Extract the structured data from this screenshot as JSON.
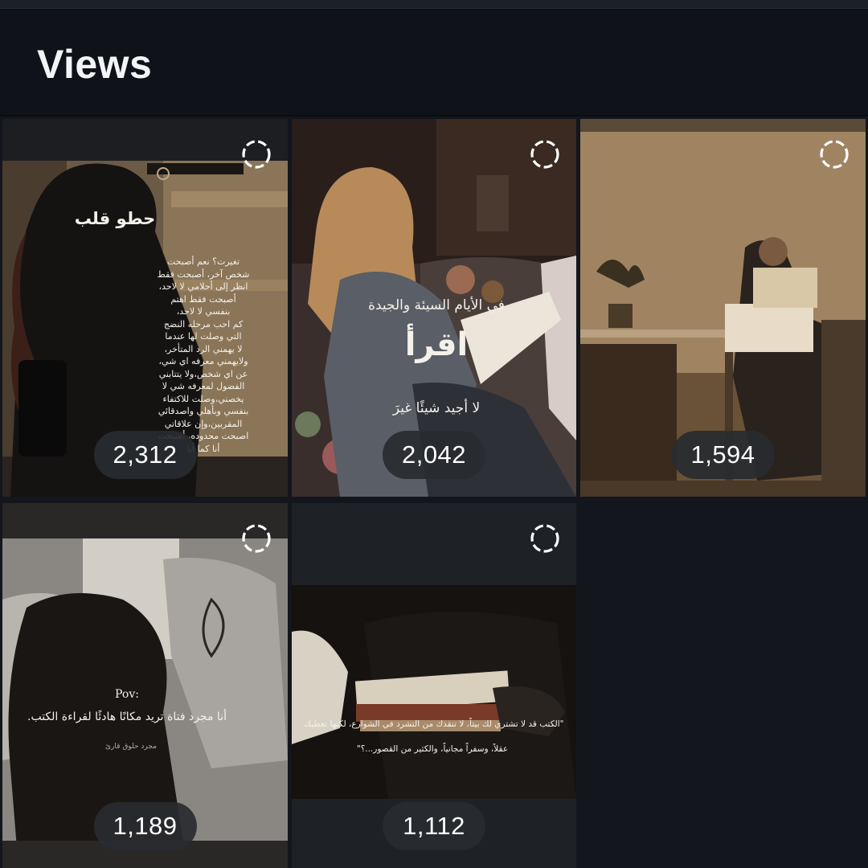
{
  "header": {
    "title": "Views"
  },
  "tiles": [
    {
      "views": "2,312",
      "overlay": {
        "heading": "حطو قلب",
        "lines": [
          "تغيرت؟ نعم أصبحت",
          "شخص آخر، أصبحت فقط",
          "انظر إلى أحلامي لا لاحد،",
          "أصبحت فقط اهتم",
          "بنفسي لا لاحد،",
          "كم احب مرحله النضج",
          "التي وصلت لها عندما",
          "لا يهمني الرد المتأخر،",
          "ولايهمني معرفه اي شي،",
          "عن اي شخص،ولا يتتابني",
          "الفضول لمعرفه شي لا",
          "يخصني،وصلت للاكتفاء",
          "بنفسي وبأهلي واصدقائي",
          "المقربين،وإن علاقاتي",
          "اصبحت محدوده، أصبحت",
          "أنا كما أنا"
        ]
      }
    },
    {
      "views": "2,042",
      "overlay": {
        "line1": "في الأيام السيئة والجيدة",
        "big": "اقرأ",
        "line3": "لا أجيد شيئًا غيرَ"
      }
    },
    {
      "views": "1,594"
    },
    {
      "views": "1,189",
      "overlay": {
        "pov": "Pov:",
        "line": "أنا مجرد فتاة تريد مكانًا هادئًا لقراءة الكتب.",
        "small": "مجرد حلوق قارئ"
      }
    },
    {
      "views": "1,112",
      "overlay": {
        "line1": "\"الكتب قد لا تشتري لك بيتاً، لا تنقذك من التشرد في الشوارع، لكنها تعطيك",
        "line2": "عقلاً، وسفراً مجانياً، والكثير من القصور...؟\""
      }
    }
  ],
  "icons": {
    "status_ring": "dashed-circle-icon"
  },
  "colors": {
    "background": "#0f1218",
    "pill": "#282b30",
    "text": "#ffffff"
  }
}
